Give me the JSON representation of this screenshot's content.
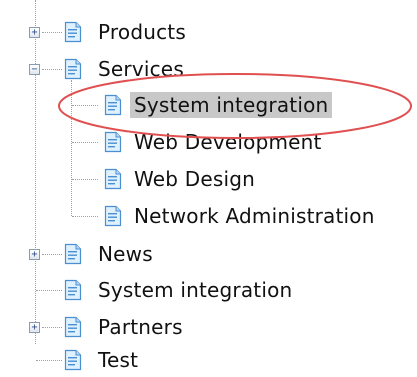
{
  "tree": {
    "nodes": [
      {
        "label": "Products",
        "expander": "+",
        "icon": "document-icon"
      },
      {
        "label": "Services",
        "expander": "−",
        "icon": "document-icon"
      },
      {
        "label": "System integration",
        "icon": "document-icon",
        "selected": true,
        "highlighted": true
      },
      {
        "label": "Web Development",
        "icon": "document-icon"
      },
      {
        "label": "Web Design",
        "icon": "document-icon"
      },
      {
        "label": "Network Administration",
        "icon": "document-icon"
      },
      {
        "label": "News",
        "expander": "+",
        "icon": "document-icon"
      },
      {
        "label": "System integration",
        "icon": "document-icon"
      },
      {
        "label": "Partners",
        "expander": "+",
        "icon": "document-icon"
      },
      {
        "label": "Test",
        "icon": "document-icon"
      }
    ]
  },
  "colors": {
    "selection": "#c8c8c8",
    "highlight_oval": "#e05050",
    "icon_fill": "#dff1ff",
    "icon_stroke": "#4a8fd0"
  }
}
